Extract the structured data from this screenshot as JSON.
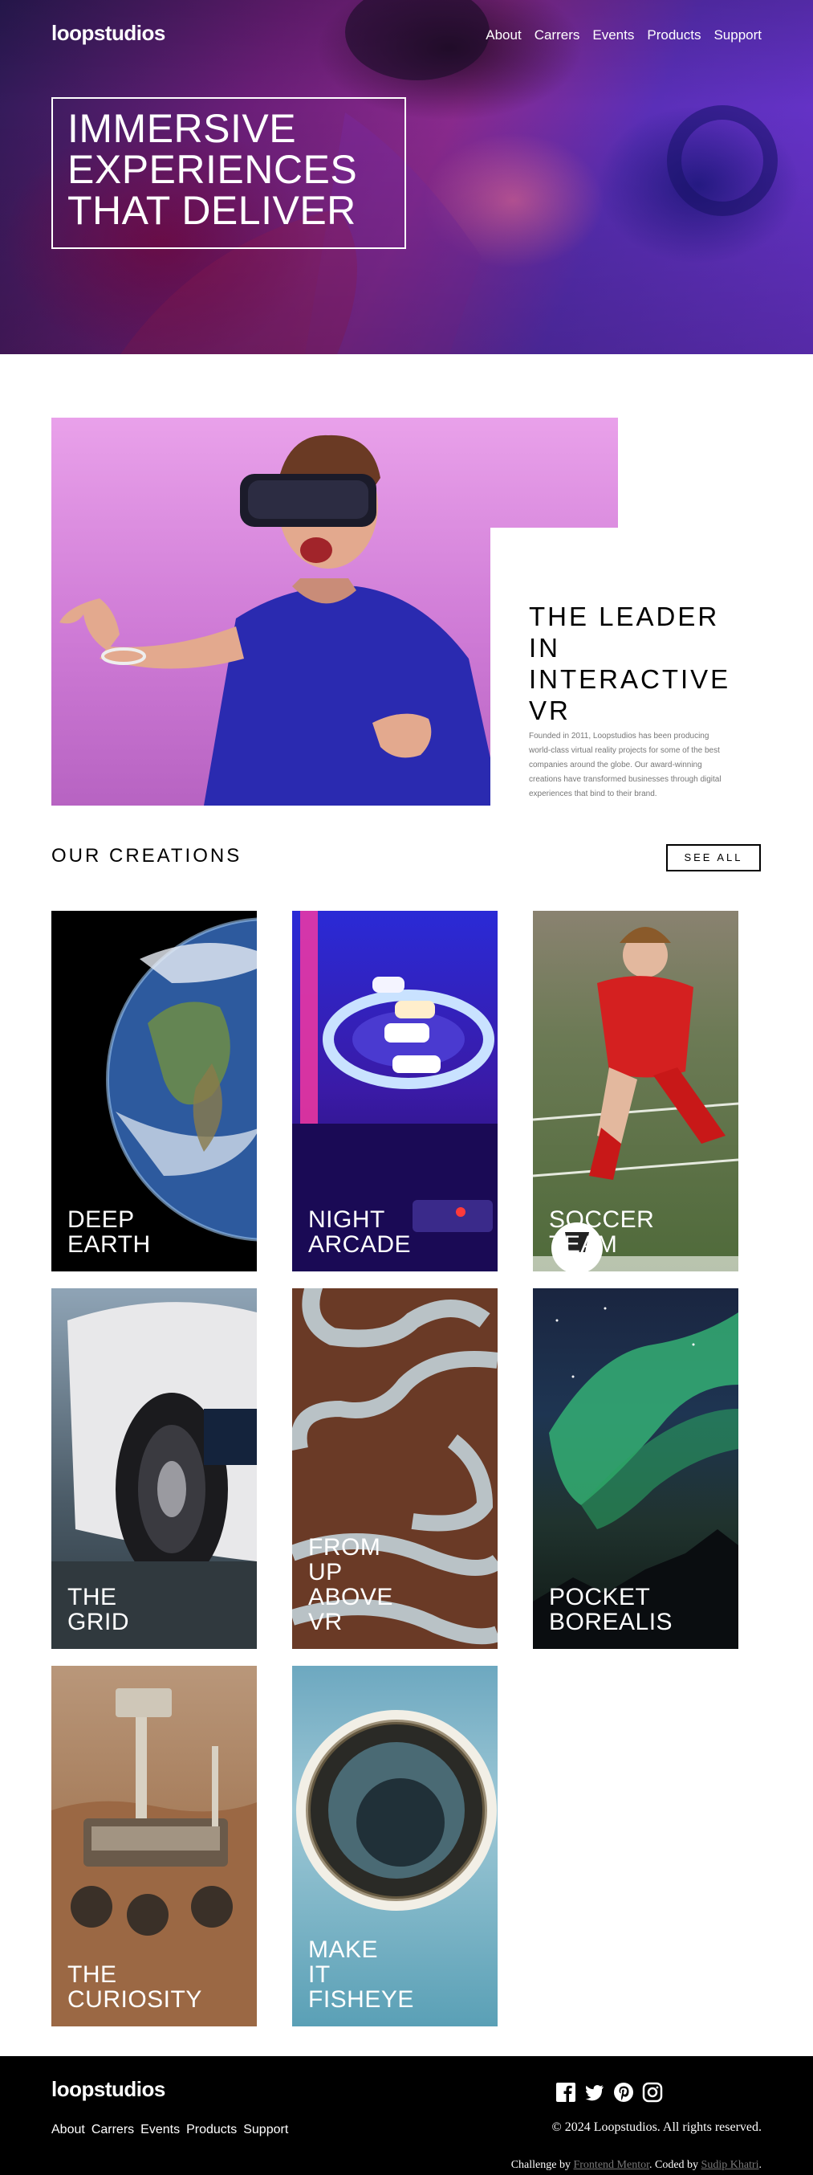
{
  "header": {
    "logo": "loopstudios",
    "nav": [
      "About",
      "Carrers",
      "Events",
      "Products",
      "Support"
    ]
  },
  "hero": {
    "lines": [
      "IMMERSIVE",
      "EXPERIENCES",
      "THAT DELIVER"
    ]
  },
  "intro": {
    "title_lines": [
      "THE LEADER",
      "IN",
      "INTERACTIVE",
      "VR"
    ],
    "text": "Founded in 2011, Loopstudios has been producing world-class virtual reality projects for some of the best companies around the globe. Our award-winning creations have transformed businesses through digital experiences that bind to their brand."
  },
  "creations": {
    "title": "OUR CREATIONS",
    "see_all": "SEE ALL",
    "cards": [
      {
        "lines": [
          "DEEP",
          "EARTH"
        ]
      },
      {
        "lines": [
          "NIGHT",
          "ARCADE"
        ]
      },
      {
        "lines": [
          "SOCCER",
          "TEAM"
        ]
      },
      {
        "lines": [
          "THE",
          "GRID"
        ]
      },
      {
        "lines": [
          "FROM",
          "UP",
          "ABOVE",
          "VR"
        ]
      },
      {
        "lines": [
          "POCKET",
          "BOREALIS"
        ]
      },
      {
        "lines": [
          "THE",
          "CURIOSITY"
        ]
      },
      {
        "lines": [
          "MAKE",
          "IT",
          "FISHEYE"
        ]
      }
    ]
  },
  "footer": {
    "logo": "loopstudios",
    "nav": [
      "About",
      "Carrers",
      "Events",
      "Products",
      "Support"
    ],
    "socials": [
      "facebook-icon",
      "twitter-icon",
      "pinterest-icon",
      "instagram-icon"
    ],
    "copyright": "© 2024 Loopstudios. All rights reserved.",
    "attribution": {
      "prefix": "Challenge by ",
      "challenge_link": "Frontend Mentor",
      "middle": ". Coded by ",
      "author_link": "Sudip Khatri",
      "suffix": "."
    }
  },
  "colors": {
    "footer_bg": "#000000",
    "muted_link": "#777777",
    "hero_purple": "#6b34d0"
  }
}
